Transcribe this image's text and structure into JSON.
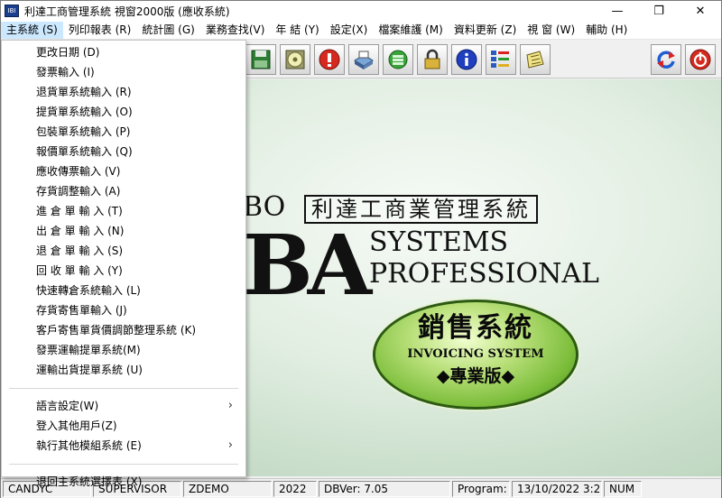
{
  "window": {
    "title": "利達工商管理系統 視窗2000版 (應收系統)",
    "app_icon_text": "IBI",
    "controls": {
      "minimize": "—",
      "maximize": "❐",
      "close": "✕"
    }
  },
  "menubar": {
    "items": [
      "主系統 (S)",
      "列印報表 (R)",
      "統計圖 (G)",
      "業務查找(V)",
      "年 結 (Y)",
      "設定(X)",
      "檔案維護 (M)",
      "資料更新 (Z)",
      "視 窗 (W)",
      "輔助 (H)"
    ]
  },
  "dropdown": {
    "group1": [
      "更改日期 (D)",
      "發票輸入 (I)",
      "退貨單系統輸入 (R)",
      "提貨單系統輸入 (O)",
      "包裝單系統輸入 (P)",
      "報價單系統輸入 (Q)",
      "應收傳票輸入 (V)",
      "存貨調整輸入 (A)",
      "進 倉 單 輸 入 (T)",
      "出 倉 單 輸 入 (N)",
      "退 倉 單 輸 入 (S)",
      "回 收 單 輸 入 (Y)",
      "快速轉倉系統輸入 (L)",
      "存貨寄售單輸入 (J)",
      "客戶寄售單貨價調節整理系統 (K)",
      "發票運輸提單系統(M)",
      "運輸出貨提單系統 (U)"
    ],
    "group2": [
      "語言設定(W)",
      "登入其他用戶(Z)",
      "執行其他模組系統 (E)"
    ],
    "group3": [
      "退回主系統選擇表 (X)"
    ],
    "submenu_arrow": "›"
  },
  "toolbar": {
    "buttons": [
      "diskette-icon",
      "cd-icon",
      "stop-icon",
      "printer-icon",
      "database-icon",
      "lock-icon",
      "info-icon",
      "list-icon",
      "notepad-icon",
      "refresh-icon",
      "power-icon"
    ]
  },
  "main": {
    "logo_prefix": "BO",
    "logo_letters": "BA",
    "logo_chinese": "利達工商業管理系統",
    "logo_systems": "SYSTEMS",
    "logo_professional": "PROFESSIONAL",
    "badge_chinese": "銷售系統",
    "badge_english": "INVOICING SYSTEM",
    "badge_edition": "◆專業版◆"
  },
  "statusbar": {
    "user": "CANDYC",
    "role": "SUPERVISOR",
    "company": "ZDEMO",
    "year": "2022",
    "dbver": "DBVer: 7.05",
    "program_label": "Program:",
    "program_time": "13/10/2022 3:29:",
    "numlock": "NUM"
  },
  "colors": {
    "menu_highlight": "#cce8ff",
    "badge_green": "#7bbd3a",
    "background_green": "#c6dcc8"
  }
}
